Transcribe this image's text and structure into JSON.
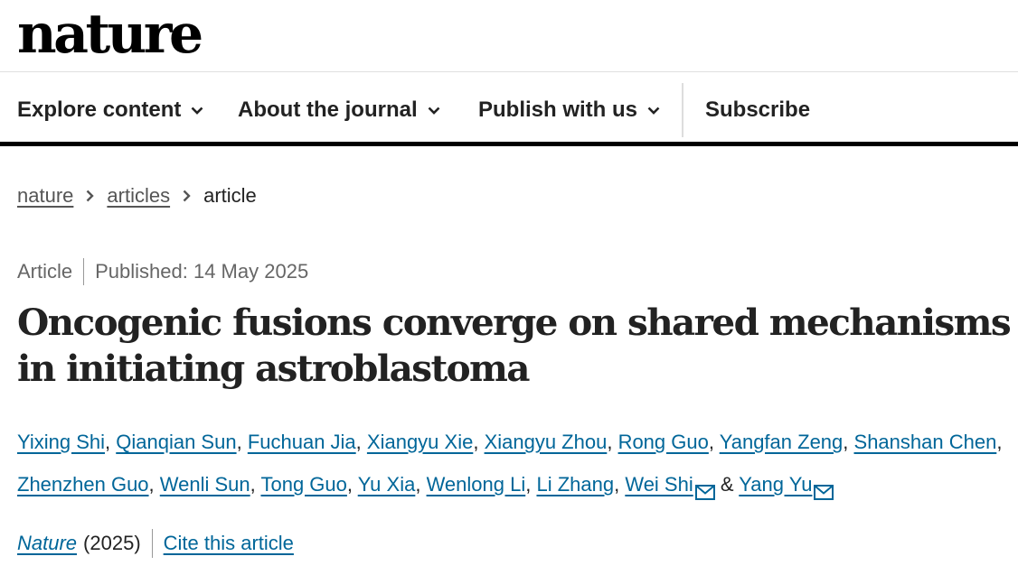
{
  "header": {
    "logo": "nature"
  },
  "nav": {
    "explore": "Explore content",
    "about": "About the journal",
    "publish": "Publish with us",
    "subscribe": "Subscribe"
  },
  "breadcrumb": {
    "home": "nature",
    "section": "articles",
    "current": "article"
  },
  "article": {
    "type": "Article",
    "published": "Published: 14 May 2025",
    "title": "Oncogenic fusions converge on shared mechanisms in initiating astroblastoma",
    "authors": [
      "Yixing Shi",
      "Qianqian Sun",
      "Fuchuan Jia",
      "Xiangyu Xie",
      "Xiangyu Zhou",
      "Rong Guo",
      "Yangfan Zeng",
      "Shanshan Chen",
      "Zhenzhen Guo",
      "Wenli Sun",
      "Tong Guo",
      "Yu Xia",
      "Wenlong Li",
      "Li Zhang",
      "Wei Shi",
      "Yang Yu"
    ],
    "and": "&",
    "journal": "Nature",
    "year": "(2025)",
    "cite": "Cite this article"
  },
  "colors": {
    "link": "#006699",
    "text": "#222222",
    "meta": "#666666",
    "rule": "#000000"
  },
  "icons": {
    "chevron": "chevron-down-icon",
    "breadcrumb_sep": "chevron-right-icon",
    "email": "envelope-icon"
  }
}
